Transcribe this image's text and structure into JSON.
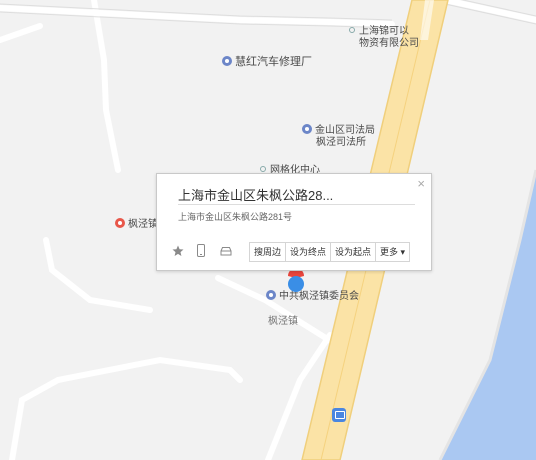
{
  "map": {
    "pois": [
      {
        "id": "shanghai-jinke",
        "lines": [
          "上海锦可以",
          "物资有限公司"
        ],
        "icon": "poi-small-icon"
      },
      {
        "id": "huihong",
        "lines": [
          "慧红汽车修理厂"
        ],
        "icon": "poi-location-icon"
      },
      {
        "id": "jinshan-judicial",
        "lines": [
          "金山区司法局",
          "枫泾司法所"
        ],
        "icon": "poi-location-icon"
      },
      {
        "id": "grid-center",
        "lines": [
          "网格化中心"
        ],
        "icon": "poi-small-icon"
      },
      {
        "id": "fengjing-left",
        "lines": [
          "枫泾镇"
        ],
        "icon": "poi-red-icon"
      },
      {
        "id": "committee",
        "lines": [
          "中共枫泾镇委员会"
        ],
        "icon": "poi-location-icon"
      }
    ],
    "area_label": "枫泾镇",
    "colors": {
      "road_main": "#fbe3a6",
      "road_edge": "#f0cf7c",
      "water": "#aac8f2",
      "land": "#f2f2f2"
    }
  },
  "popup": {
    "title": "上海市金山区朱枫公路28...",
    "address": "上海市金山区朱枫公路281号",
    "close_label": "×",
    "buttons": [
      "搜周边",
      "设为终点",
      "设为起点",
      "更多 ▾"
    ],
    "icons": [
      "star-icon",
      "phone-icon",
      "car-icon"
    ]
  }
}
